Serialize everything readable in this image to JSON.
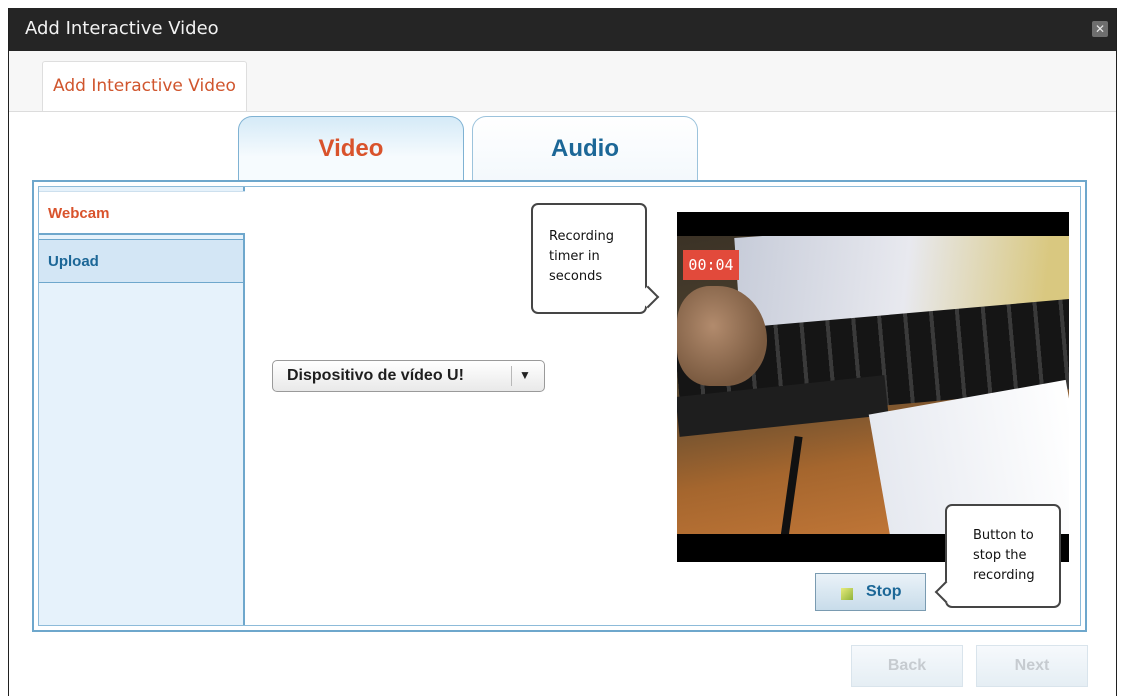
{
  "window": {
    "title": "Add Interactive Video",
    "close_glyph": "✕"
  },
  "outer_tab": {
    "label": "Add Interactive Video"
  },
  "media_tabs": [
    {
      "label": "Video",
      "selected": true
    },
    {
      "label": "Audio",
      "selected": false
    }
  ],
  "sidebar": {
    "items": [
      {
        "label": "Webcam",
        "selected": true
      },
      {
        "label": "Upload",
        "selected": false
      }
    ]
  },
  "device_select": {
    "value": "Dispositivo de vídeo U!",
    "arrow_glyph": "▼"
  },
  "video": {
    "timer": "00:04"
  },
  "callouts": {
    "timer": "Recording timer in seconds",
    "stop": "Button to stop the recording"
  },
  "stop_button": {
    "label": "Stop"
  },
  "footer": {
    "back_label": "Back",
    "next_label": "Next"
  },
  "colors": {
    "accent_orange": "#d9532c",
    "accent_blue": "#1c6797",
    "border_blue": "#6ea7cc",
    "timer_red": "#e24a3b"
  }
}
